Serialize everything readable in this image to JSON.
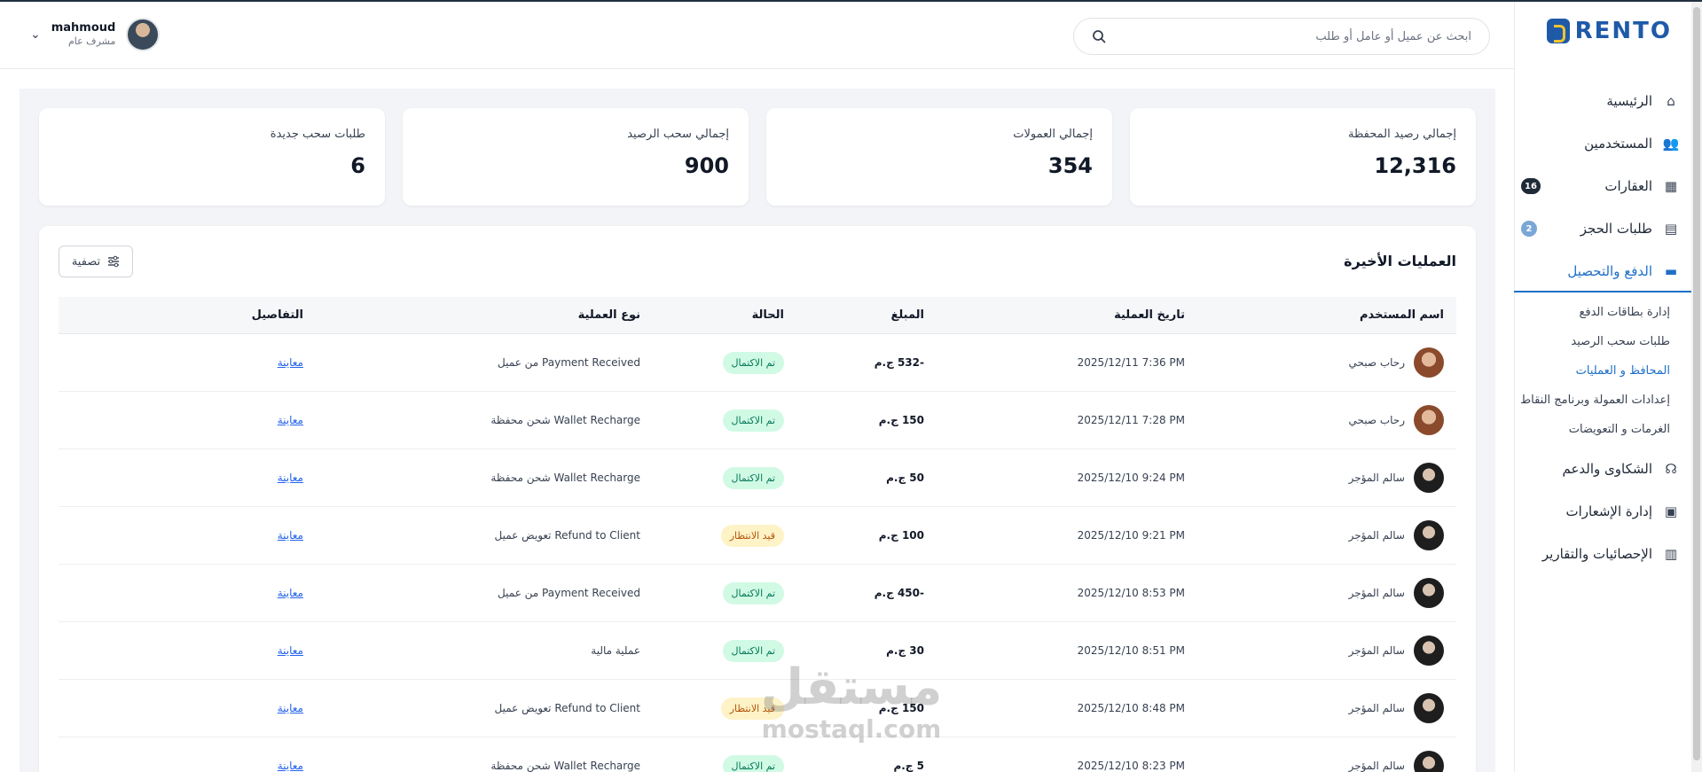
{
  "brand": {
    "name": "RENTO",
    "primary": "#1e5aa8",
    "accent": "#f2c230"
  },
  "header": {
    "search_placeholder": "ابحث عن عميل أو عامل أو طلب",
    "user_name": "mahmoud",
    "user_role": "مشرف عام"
  },
  "sidebar": {
    "items": [
      {
        "label": "الرئيسية",
        "icon": "home-icon"
      },
      {
        "label": "المستخدمين",
        "icon": "users-icon"
      },
      {
        "label": "العقارات",
        "icon": "building-icon",
        "badge": "16"
      },
      {
        "label": "طلبات الحجز",
        "icon": "clipboard-icon",
        "badge": "2"
      },
      {
        "label": "الدفع والتحصيل",
        "icon": "wallet-icon",
        "active": true
      },
      {
        "label": "الشكاوى والدعم",
        "icon": "headset-icon"
      },
      {
        "label": "إدارة الإشعارات",
        "icon": "gift-icon"
      },
      {
        "label": "الإحصائيات والتقارير",
        "icon": "chart-icon"
      }
    ],
    "sub_items": [
      {
        "label": "إدارة بطاقات الدفع"
      },
      {
        "label": "طلبات سحب الرصيد"
      },
      {
        "label": "المحافظ و العمليات",
        "active": true
      },
      {
        "label": "إعدادات العمولة وبرنامج النقاط"
      },
      {
        "label": "الغرمات و التعويضات"
      }
    ]
  },
  "stats": [
    {
      "title": "إجمالي رصيد المحفظة",
      "value": "12,316"
    },
    {
      "title": "إجمالي العمولات",
      "value": "354"
    },
    {
      "title": "إجمالي سحب الرصيد",
      "value": "900"
    },
    {
      "title": "طلبات سحب جديدة",
      "value": "6"
    }
  ],
  "transactions": {
    "title": "العمليات الأخيرة",
    "filter_label": "تصفية",
    "columns": [
      "اسم المستخدم",
      "تاريخ العملية",
      "المبلغ",
      "الحالة",
      "نوع العملية",
      "التفاصيل"
    ],
    "rows": [
      {
        "user": "رحاب صبحي",
        "date": "2025/12/11 7:36 PM",
        "amount": "-532 ج.م",
        "status": "تم الاكتمال",
        "type": "Payment Received من عميل",
        "details": "معاينة"
      },
      {
        "user": "رحاب صبحي",
        "date": "2025/12/11 7:28 PM",
        "amount": "150 ج.م",
        "status": "تم الاكتمال",
        "type": "Wallet Recharge شحن محفظة",
        "details": "معاينة"
      },
      {
        "user": "سالم المؤجر",
        "date": "2025/12/10 9:24 PM",
        "amount": "50 ج.م",
        "status": "تم الاكتمال",
        "type": "Wallet Recharge شحن محفظة",
        "details": "معاينة"
      },
      {
        "user": "سالم المؤجر",
        "date": "2025/12/10 9:21 PM",
        "amount": "100 ج.م",
        "status": "قيد الانتظار",
        "type": "Refund to Client تعويض عميل",
        "details": "معاينة"
      },
      {
        "user": "سالم المؤجر",
        "date": "2025/12/10 8:53 PM",
        "amount": "-450 ج.م",
        "status": "تم الاكتمال",
        "type": "Payment Received من عميل",
        "details": "معاينة"
      },
      {
        "user": "سالم المؤجر",
        "date": "2025/12/10 8:51 PM",
        "amount": "30 ج.م",
        "status": "تم الاكتمال",
        "type": "عملية مالية",
        "details": "معاينة"
      },
      {
        "user": "سالم المؤجر",
        "date": "2025/12/10 8:48 PM",
        "amount": "150 ج.م",
        "status": "قيد الانتظار",
        "type": "Refund to Client تعويض عميل",
        "details": "معاينة"
      },
      {
        "user": "سالم المؤجر",
        "date": "2025/12/10 8:23 PM",
        "amount": "5 ج.م",
        "status": "تم الاكتمال",
        "type": "Wallet Recharge شحن محفظة",
        "details": "معاينة"
      }
    ]
  },
  "watermark": {
    "ar": "مستقل",
    "en": "mostaql.com"
  }
}
